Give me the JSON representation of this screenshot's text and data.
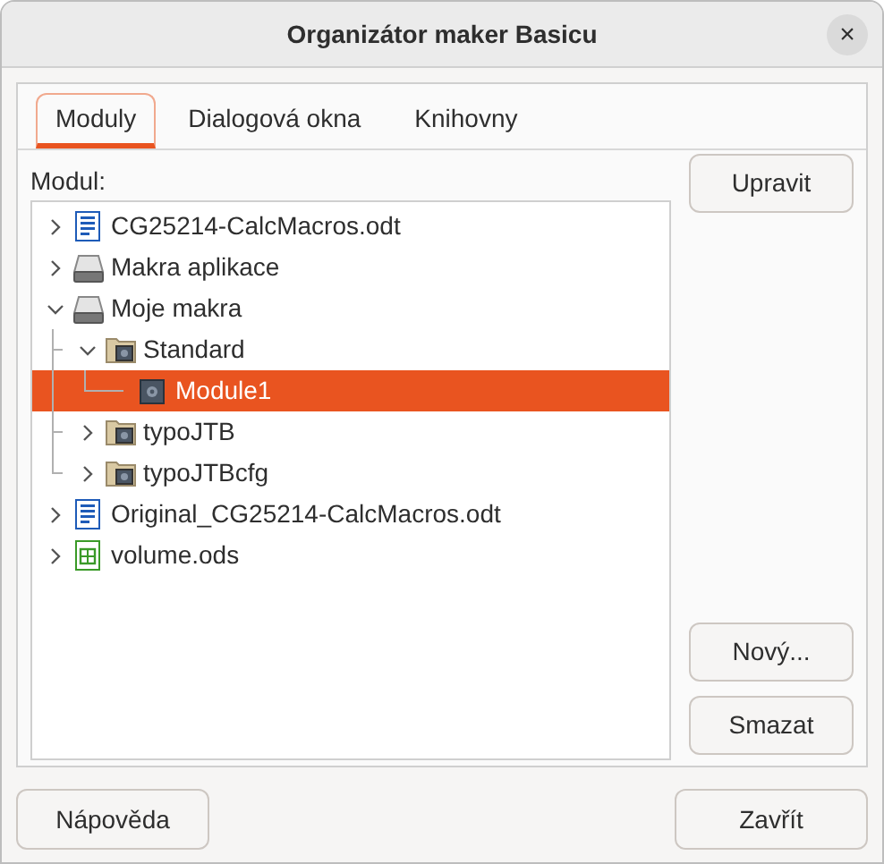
{
  "window": {
    "title": "Organizátor maker Basicu",
    "close": "×"
  },
  "tabs": [
    {
      "label": "Moduly",
      "selected": true
    },
    {
      "label": "Dialogová okna",
      "selected": false
    },
    {
      "label": "Knihovny",
      "selected": false
    }
  ],
  "tree_label": "Modul:",
  "tree": [
    {
      "label": "CG25214-CalcMacros.odt",
      "kind": "odt",
      "expanded": false,
      "selected": false
    },
    {
      "label": "Makra aplikace",
      "kind": "drive",
      "expanded": false,
      "selected": false
    },
    {
      "label": "Moje makra",
      "kind": "drive",
      "expanded": true,
      "selected": false,
      "children": [
        {
          "label": "Standard",
          "kind": "library",
          "expanded": true,
          "selected": false,
          "children": [
            {
              "label": "Module1",
              "kind": "module",
              "selected": true
            }
          ]
        },
        {
          "label": "typoJTB",
          "kind": "library",
          "expanded": false,
          "selected": false
        },
        {
          "label": "typoJTBcfg",
          "kind": "library",
          "expanded": false,
          "selected": false
        }
      ]
    },
    {
      "label": "Original_CG25214-CalcMacros.odt",
      "kind": "odt",
      "expanded": false,
      "selected": false
    },
    {
      "label": "volume.ods",
      "kind": "ods",
      "expanded": false,
      "selected": false
    }
  ],
  "side_buttons": [
    "Upravit",
    "Nový...",
    "Smazat"
  ],
  "footer_buttons": [
    "Nápověda",
    "Zavřít"
  ]
}
